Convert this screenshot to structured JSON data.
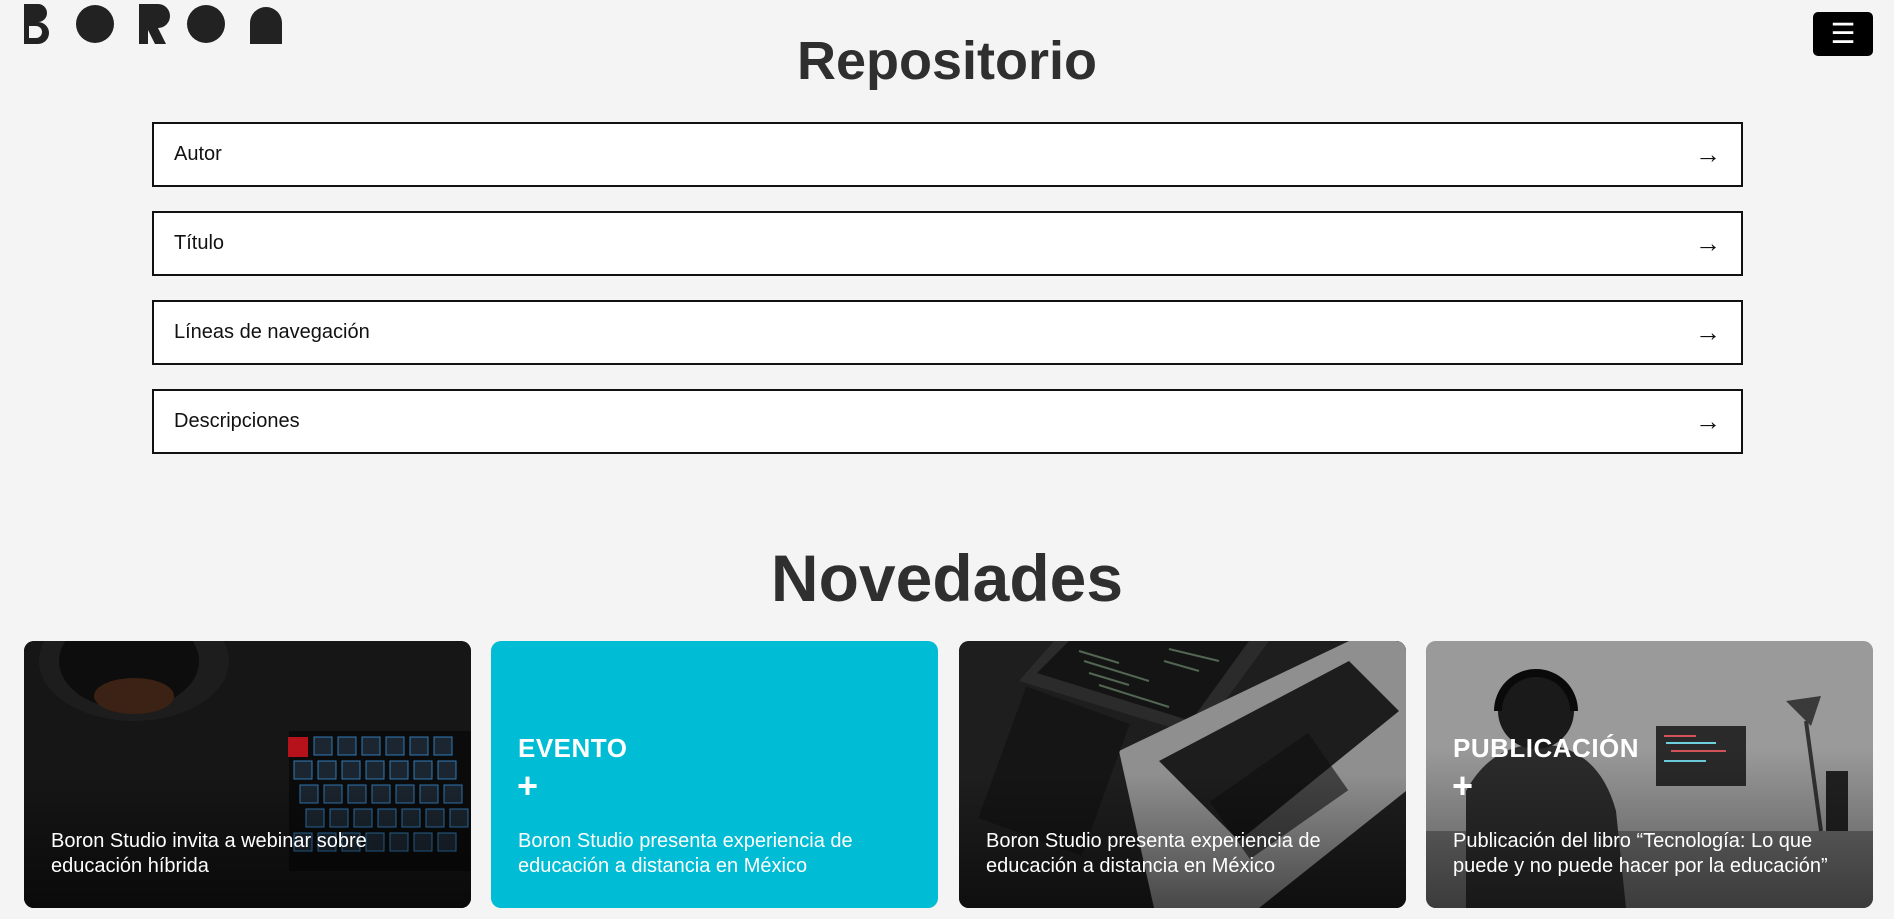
{
  "brand": {
    "name": "BORON"
  },
  "nav": {
    "menu_icon": "hamburger-icon"
  },
  "repositorio": {
    "title": "Repositorio",
    "items": [
      {
        "label": "Autor",
        "arrow": "→"
      },
      {
        "label": "Título",
        "arrow": "→"
      },
      {
        "label": "Líneas de navegación",
        "arrow": "→"
      },
      {
        "label": "Descripciones",
        "arrow": "→"
      }
    ]
  },
  "novedades": {
    "title": "Novedades",
    "cards": [
      {
        "caption": "Boron Studio invita a webinar sobre educación híbrida",
        "image": "coffee-keyboard-photo"
      },
      {
        "tag": "EVENTO",
        "plus": "+",
        "caption": "Boron Studio presenta experiencia de educación a distancia en México",
        "color": "#00bcd4"
      },
      {
        "caption": "Boron Studio presenta experiencia de educación a distancia en México",
        "image": "laptop-photo"
      },
      {
        "tag": "PUBLICACIÓN",
        "plus": "+",
        "caption": "Publicación del libro “Tecnología: Lo que puede y no puede hacer por la educación”",
        "image": "person-desk-photo"
      }
    ]
  }
}
